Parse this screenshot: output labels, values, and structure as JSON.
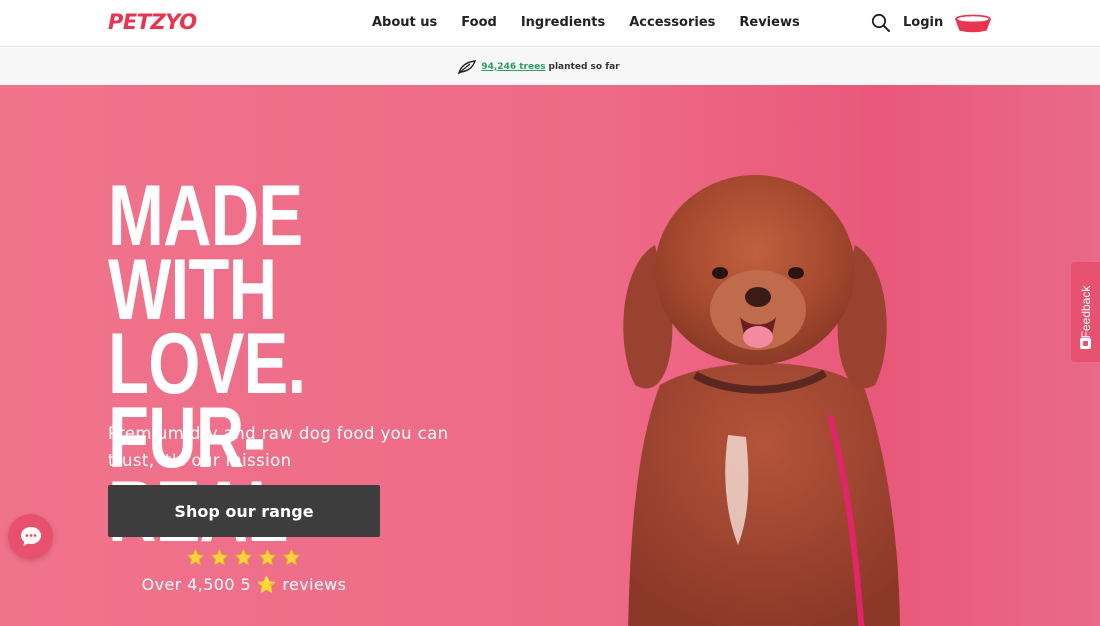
{
  "brand": {
    "logo_text": "PETZYO",
    "accent": "#e8344e"
  },
  "nav": {
    "items": [
      {
        "label": "About us"
      },
      {
        "label": "Food"
      },
      {
        "label": "Ingredients"
      },
      {
        "label": "Accessories"
      },
      {
        "label": "Reviews"
      }
    ],
    "login_label": "Login"
  },
  "announcement": {
    "trees_link": "94,246 trees",
    "suffix": "planted so far"
  },
  "hero": {
    "headline_lines": [
      "MADE WITH",
      "LOVE. FUR-",
      "REAL"
    ],
    "subtitle": "Premium dry and raw dog food you can trust, it's our mission",
    "cta_label": "Shop our range",
    "rating_stars": 5,
    "reviews_prefix": "Over 4,500 5",
    "reviews_star": "⭐",
    "reviews_suffix": "reviews"
  },
  "feedback_label": "Feedback",
  "colors": {
    "hero_bg": "#ee6a86",
    "cta_bg": "#3d3d3d",
    "star": "#f7d23e",
    "link_green": "#2f9e63"
  }
}
